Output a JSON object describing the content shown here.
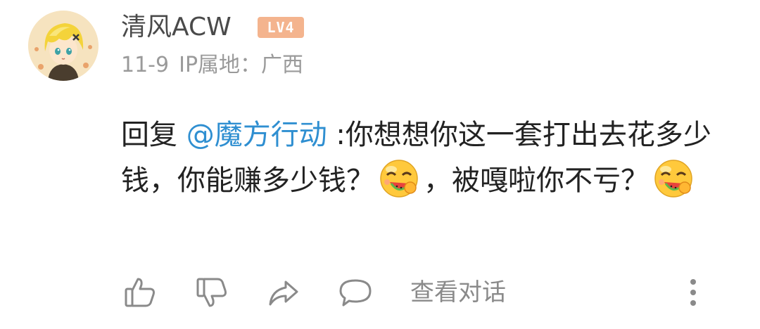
{
  "user": {
    "name": "清风ACW",
    "level_badge": "LV4",
    "date": "11-9",
    "ip_location": "IP属地：广西"
  },
  "comment": {
    "reply_prefix": "回复 ",
    "mention": "@魔方行动",
    "text_part1": " :你想想你这一套打出去花多少钱，你能赚多少钱？",
    "emoji_1": "watermelon-laugh-emoji",
    "text_part2": "，被嘎啦你不亏？",
    "emoji_2": "watermelon-laugh-emoji"
  },
  "actions": {
    "like_icon": "thumbs-up-icon",
    "dislike_icon": "thumbs-down-icon",
    "share_icon": "share-icon",
    "comment_icon": "comment-bubble-icon",
    "view_conversation_label": "查看对话",
    "more_icon": "more-vertical-icon"
  },
  "colors": {
    "mention": "#2f8fd1",
    "badge": "#f4b48e",
    "meta_text": "#9a9a9a",
    "icon": "#8a8a8a"
  }
}
